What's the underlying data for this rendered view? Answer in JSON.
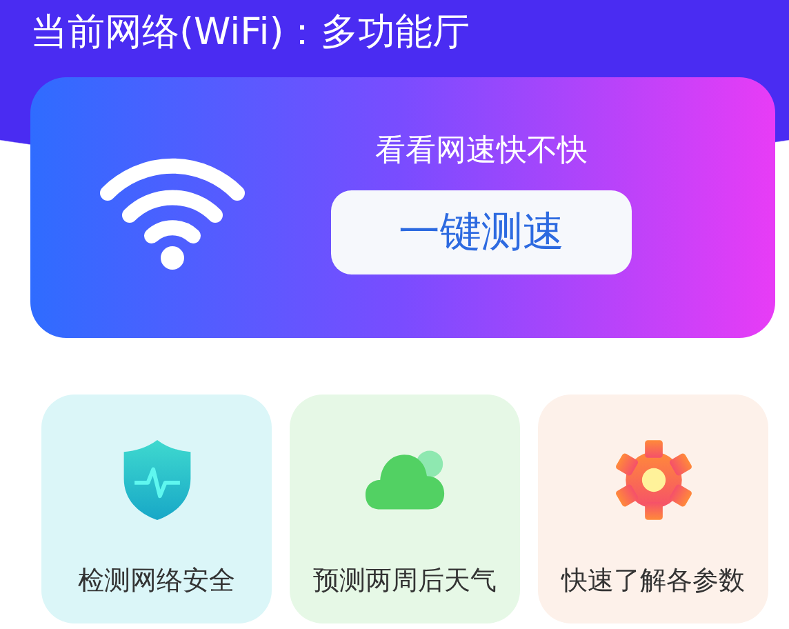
{
  "header": {
    "title": "当前网络(WiFi)：多功能厅"
  },
  "speed_card": {
    "prompt": "看看网速快不快",
    "button": "一键测速"
  },
  "tiles": [
    {
      "kind": "shield",
      "label": "检测网络安全",
      "color": "#dbf6f8"
    },
    {
      "kind": "cloud",
      "label": "预测两周后天气",
      "color": "#e6f8e6"
    },
    {
      "kind": "gear",
      "label": "快速了解各参数",
      "color": "#fdf1ea"
    }
  ]
}
